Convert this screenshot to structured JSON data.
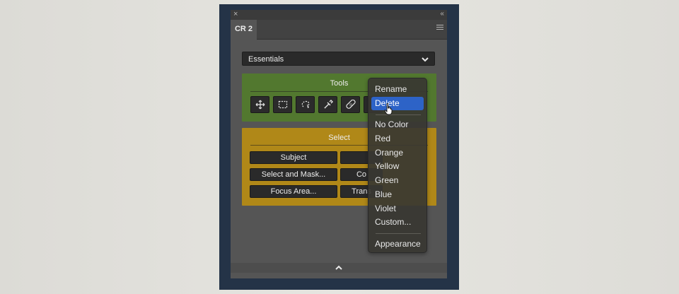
{
  "panel": {
    "tab_label": "CR 2",
    "close_icon": "close-icon",
    "collapse_icon": "double-chevron-icon",
    "menu_icon": "hamburger-icon"
  },
  "workspace_dropdown": {
    "selected": "Essentials"
  },
  "tools_group": {
    "title": "Tools",
    "color": "#52782f",
    "tools": [
      "move-icon",
      "marquee-icon",
      "lasso-icon",
      "eyedropper-icon",
      "healing-bandage-icon"
    ]
  },
  "select_group": {
    "title": "Select",
    "color": "#b08818",
    "buttons": [
      "Subject",
      "Select and Mask...",
      "Co",
      "Focus Area...",
      "Trans"
    ]
  },
  "context_menu": {
    "items": [
      "Rename",
      "Delete",
      "No Color",
      "Red",
      "Orange",
      "Yellow",
      "Green",
      "Blue",
      "Violet",
      "Custom...",
      "Appearance"
    ],
    "highlighted": "Delete",
    "highlight_color": "#2d63c7"
  }
}
